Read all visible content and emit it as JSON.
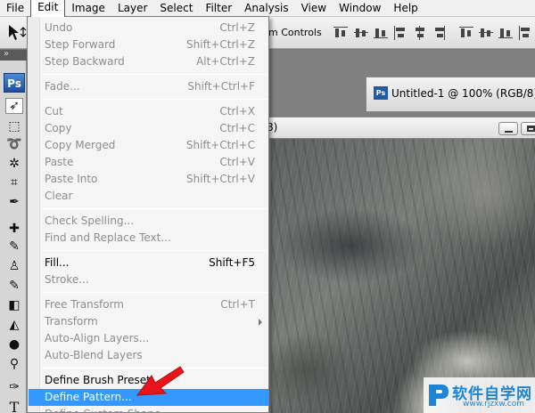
{
  "menubar": {
    "items": [
      "File",
      "Edit",
      "Image",
      "Layer",
      "Select",
      "Filter",
      "Analysis",
      "View",
      "Window",
      "Help"
    ],
    "active": "Edit"
  },
  "optionsbar": {
    "controls_label": "m Controls"
  },
  "toolbox": {
    "logo": "Ps",
    "dock_grip": "»",
    "tools": [
      "move-tool-icon",
      "marquee-tool-icon",
      "lasso-tool-icon",
      "magic-wand-tool-icon",
      "crop-tool-icon",
      "eyedropper-tool-icon",
      "healing-brush-tool-icon",
      "brush-tool-icon",
      "clone-stamp-tool-icon",
      "history-brush-tool-icon",
      "eraser-tool-icon",
      "paint-bucket-tool-icon",
      "blur-tool-icon",
      "dodge-tool-icon",
      "pen-tool-icon",
      "type-tool-icon"
    ],
    "type_glyph": "T"
  },
  "documents": {
    "background_tab_title": "Untitled-1 @ 100% (RGB/8)",
    "background_tab_badge": "Ps",
    "front_title_fragment": "8)"
  },
  "edit_menu": {
    "groups": [
      [
        {
          "label": "Undo",
          "shortcut": "Ctrl+Z",
          "enabled": false
        },
        {
          "label": "Step Forward",
          "shortcut": "Shift+Ctrl+Z",
          "enabled": false
        },
        {
          "label": "Step Backward",
          "shortcut": "Alt+Ctrl+Z",
          "enabled": false
        }
      ],
      [
        {
          "label": "Fade...",
          "shortcut": "Shift+Ctrl+F",
          "enabled": false
        }
      ],
      [
        {
          "label": "Cut",
          "shortcut": "Ctrl+X",
          "enabled": false
        },
        {
          "label": "Copy",
          "shortcut": "Ctrl+C",
          "enabled": false
        },
        {
          "label": "Copy Merged",
          "shortcut": "Shift+Ctrl+C",
          "enabled": false
        },
        {
          "label": "Paste",
          "shortcut": "Ctrl+V",
          "enabled": false
        },
        {
          "label": "Paste Into",
          "shortcut": "Shift+Ctrl+V",
          "enabled": false
        },
        {
          "label": "Clear",
          "shortcut": "",
          "enabled": false
        }
      ],
      [
        {
          "label": "Check Spelling...",
          "shortcut": "",
          "enabled": false
        },
        {
          "label": "Find and Replace Text...",
          "shortcut": "",
          "enabled": false
        }
      ],
      [
        {
          "label": "Fill...",
          "shortcut": "Shift+F5",
          "enabled": true
        },
        {
          "label": "Stroke...",
          "shortcut": "",
          "enabled": false
        }
      ],
      [
        {
          "label": "Free Transform",
          "shortcut": "Ctrl+T",
          "enabled": false
        },
        {
          "label": "Transform",
          "shortcut": "",
          "enabled": false,
          "submenu": true
        },
        {
          "label": "Auto-Align Layers...",
          "shortcut": "",
          "enabled": false
        },
        {
          "label": "Auto-Blend Layers",
          "shortcut": "",
          "enabled": false
        }
      ],
      [
        {
          "label": "Define Brush Preset...",
          "shortcut": "",
          "enabled": true
        },
        {
          "label": "Define Pattern...",
          "shortcut": "",
          "enabled": true,
          "highlighted": true
        },
        {
          "label": "Define Custom Shape...",
          "shortcut": "",
          "enabled": false
        }
      ]
    ]
  },
  "annotation": {
    "arrow_color": "#e8141b"
  },
  "watermark": {
    "text": "软件自学网",
    "url": "www.rjzxw.com",
    "color": "#1e84d6"
  },
  "colors": {
    "highlight": "#3399ff",
    "disabled_text": "#8d8d8d"
  }
}
